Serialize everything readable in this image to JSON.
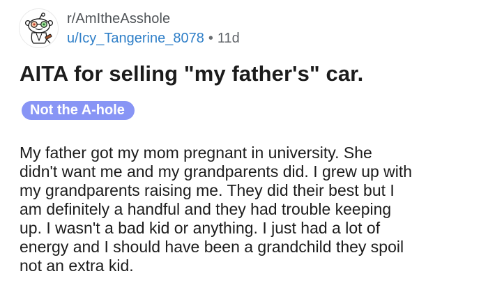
{
  "post": {
    "subreddit": "r/AmItheAsshole",
    "username": "u/Icy_Tangerine_8078",
    "separator": "•",
    "age": "11d",
    "avatar_icon": "snoo-avatar-icon",
    "title": "AITA for selling \"my father's\" car.",
    "flair": {
      "label": "Not the A-hole",
      "color": "#8895f5"
    },
    "body_lines": [
      "My father got my mom pregnant in university.  She",
      "didn't want me and my grandparents did. I grew up with",
      "my grandparents raising me.  They did their best but I",
      "am definitely a handful and they had trouble keeping",
      "up.  I wasn't a bad kid or anything. I just had a lot of",
      "energy and I should have been a grandchild they spoil",
      "not an extra kid."
    ]
  }
}
